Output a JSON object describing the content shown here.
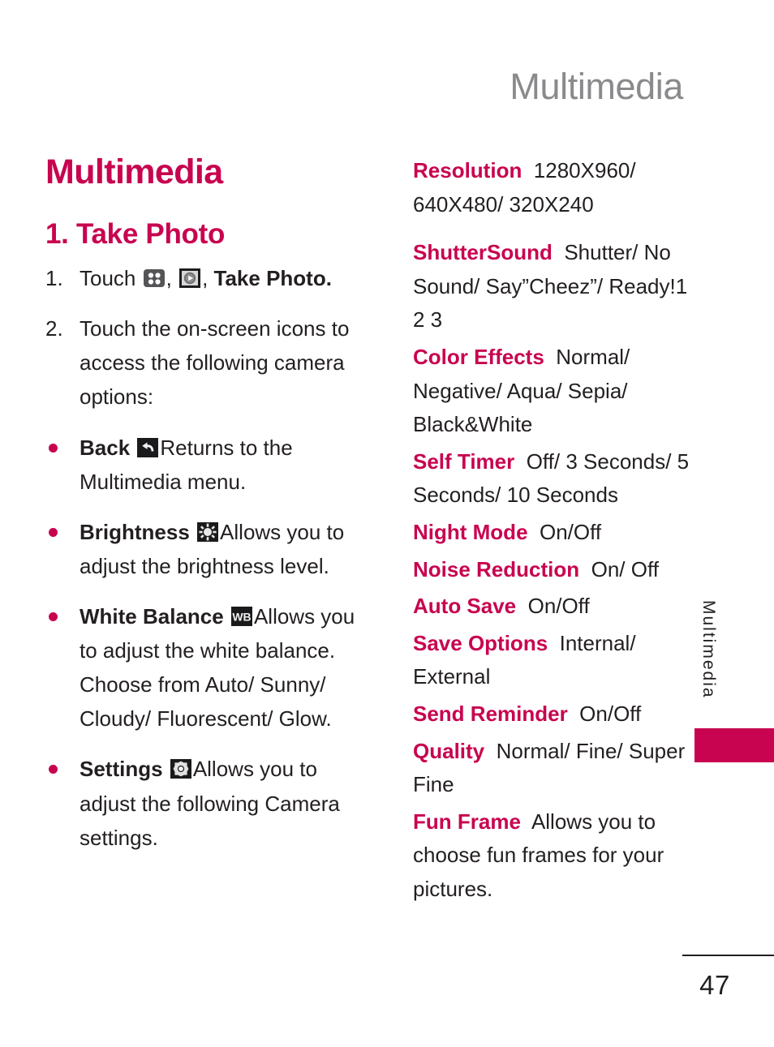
{
  "running_head": "Multimedia",
  "left_column": {
    "chapter_title": "Multimedia",
    "section_title": "1. Take Photo",
    "steps": [
      {
        "number": "1.",
        "pre": "Touch ",
        "icon_1": "apps-grid-icon",
        "mid_1": ", ",
        "icon_2": "media-play-icon",
        "mid_2": ", ",
        "bold_tail": "Take Photo",
        "post": "."
      },
      {
        "number": "2.",
        "text": "Touch the on-screen icons to access the following camera options:"
      }
    ],
    "options": [
      {
        "term": "Back",
        "icon": "back-arrow-icon",
        "description": "Returns to the Multimedia menu."
      },
      {
        "term": "Brightness",
        "icon": "brightness-sun-icon",
        "description": "Allows you to adjust the brightness level."
      },
      {
        "term": "White Balance",
        "icon": "white-balance-wb-icon",
        "description": "Allows you to adjust the white balance. Choose from Auto/ Sunny/ Cloudy/ Fluorescent/ Glow."
      },
      {
        "term": "Settings",
        "icon": "settings-gear-icon",
        "description": "Allows you to adjust the following Camera settings."
      }
    ]
  },
  "right_column": {
    "settings": [
      {
        "label": "Resolution",
        "value": "1280X960/ 640X480/ 320X240",
        "gap": true
      },
      {
        "label": "ShutterSound",
        "value": "Shutter/ No Sound/ Say”Cheez”/ Ready!1 2 3",
        "gap": false
      },
      {
        "label": "Color Effects",
        "value": "Normal/ Negative/ Aqua/ Sepia/ Black&White",
        "gap": false
      },
      {
        "label": "Self Timer",
        "value": "Off/ 3 Seconds/ 5 Seconds/ 10 Seconds",
        "gap": false
      },
      {
        "label": "Night Mode",
        "value": "On/Off",
        "gap": false
      },
      {
        "label": "Noise Reduction",
        "value": "On/ Off",
        "gap": false
      },
      {
        "label": "Auto Save",
        "value": "On/Off",
        "gap": false
      },
      {
        "label": "Save Options",
        "value": "Internal/ External",
        "gap": false
      },
      {
        "label": "Send Reminder",
        "value": "On/Off",
        "gap": false
      },
      {
        "label": "Quality",
        "value": "Normal/ Fine/ Super Fine",
        "gap": false
      },
      {
        "label": "Fun Frame",
        "value": "Allows you to choose fun frames for your pictures.",
        "gap": false
      }
    ]
  },
  "side_tab": {
    "text": "Multimedia",
    "accent_color": "#c8034f"
  },
  "footer": {
    "page_number": "47"
  },
  "colors": {
    "accent": "#c8034f",
    "body_text": "#231f20",
    "running_head": "#8a8a8d"
  }
}
